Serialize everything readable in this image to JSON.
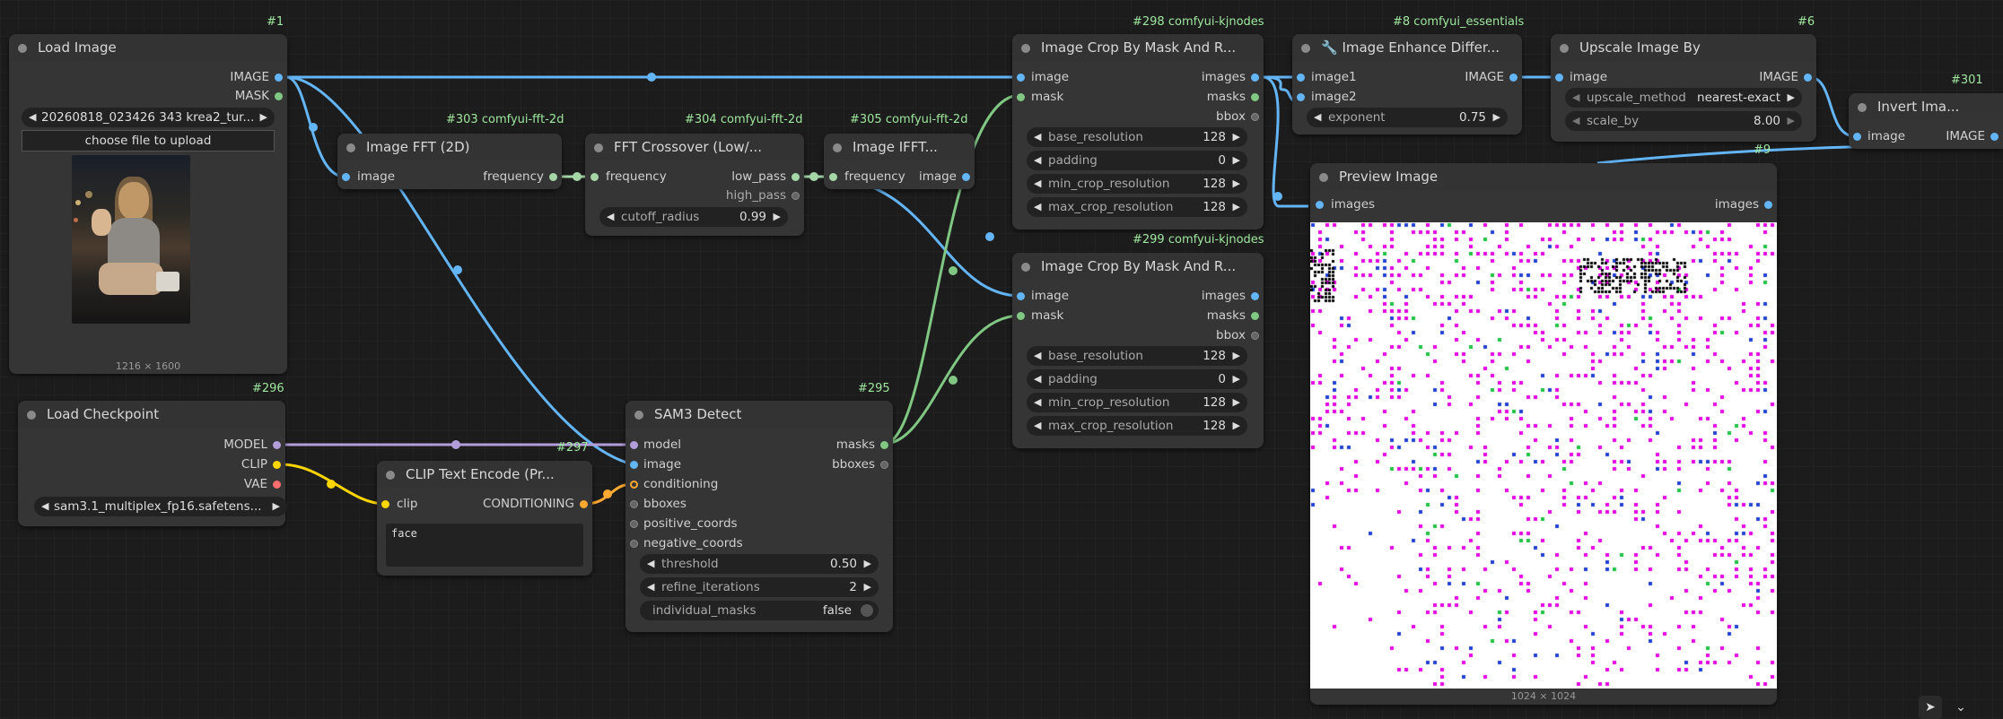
{
  "nodes": {
    "load_image": {
      "id": "#1",
      "title": "Load Image",
      "out_image": "IMAGE",
      "out_mask": "MASK",
      "file": "20260818_023426 343 krea2_tur...",
      "upload": "choose file to upload",
      "caption": "1216 × 1600"
    },
    "load_checkpoint": {
      "id": "#296",
      "title": "Load Checkpoint",
      "out_model": "MODEL",
      "out_clip": "CLIP",
      "out_vae": "VAE",
      "ckpt": "sam3.1_multiplex_fp16.safetens..."
    },
    "image_fft": {
      "id": "#303 comfyui-fft-2d",
      "title": "Image FFT (2D)",
      "in_image": "image",
      "out_frequency": "frequency"
    },
    "fft_crossover": {
      "id": "#304 comfyui-fft-2d",
      "title": "FFT Crossover (Low/...",
      "in_frequency": "frequency",
      "out_low": "low_pass",
      "out_high": "high_pass",
      "w_label": "cutoff_radius",
      "w_value": "0.99"
    },
    "image_ifft": {
      "id": "#305 comfyui-fft-2d",
      "title": "Image IFFT...",
      "in_frequency": "frequency",
      "out_image": "image"
    },
    "clip_text": {
      "id": "#297",
      "title": "CLIP Text Encode (Pr...",
      "in_clip": "clip",
      "out_cond": "CONDITIONING",
      "text": "face"
    },
    "sam3": {
      "id": "#295",
      "title": "SAM3 Detect",
      "in_model": "model",
      "in_image": "image",
      "in_cond": "conditioning",
      "in_bboxes": "bboxes",
      "in_pos": "positive_coords",
      "in_neg": "negative_coords",
      "out_masks": "masks",
      "out_bboxes": "bboxes",
      "w_threshold_label": "threshold",
      "w_threshold": "0.50",
      "w_refine_label": "refine_iterations",
      "w_refine": "2",
      "w_indiv_label": "individual_masks",
      "w_indiv": "false"
    },
    "crop1": {
      "id": "#298 comfyui-kjnodes",
      "title": "Image Crop By Mask And R...",
      "in_image": "image",
      "in_mask": "mask",
      "out_images": "images",
      "out_masks": "masks",
      "out_bbox": "bbox",
      "w1l": "base_resolution",
      "w1": "128",
      "w2l": "padding",
      "w2": "0",
      "w3l": "min_crop_resolution",
      "w3": "128",
      "w4l": "max_crop_resolution",
      "w4": "128"
    },
    "crop2": {
      "id": "#299 comfyui-kjnodes",
      "title": "Image Crop By Mask And R...",
      "in_image": "image",
      "in_mask": "mask",
      "out_images": "images",
      "out_masks": "masks",
      "out_bbox": "bbox",
      "w1l": "base_resolution",
      "w1": "128",
      "w2l": "padding",
      "w2": "0",
      "w3l": "min_crop_resolution",
      "w3": "128",
      "w4l": "max_crop_resolution",
      "w4": "128"
    },
    "enhance": {
      "id": "#8 comfyui_essentials",
      "title": "🔧 Image Enhance Differ...",
      "in_image1": "image1",
      "in_image2": "image2",
      "out_image": "IMAGE",
      "w_label": "exponent",
      "w_value": "0.75"
    },
    "upscale": {
      "id": "#6",
      "title": "Upscale Image By",
      "in_image": "image",
      "out_image": "IMAGE",
      "w1l": "upscale_method",
      "w1": "nearest-exact",
      "w2l": "scale_by",
      "w2": "8.00"
    },
    "invert": {
      "id": "#301",
      "title": "Invert Ima...",
      "in_image": "image",
      "out_image": "IMAGE"
    },
    "preview": {
      "id": "#9",
      "title": "Preview Image",
      "in_images": "images",
      "out_images": "images",
      "caption": "1024 × 1024"
    }
  },
  "colors": {
    "image": "#64b5f6",
    "mask": "#81c784",
    "model": "#b39ddb",
    "clip": "#ffd500",
    "conditioning": "#ffa931",
    "vae": "#ff6e6e"
  },
  "toolbar": {
    "pointer_icon": "pointer-icon",
    "chevron_icon": "chevron-down-icon"
  }
}
